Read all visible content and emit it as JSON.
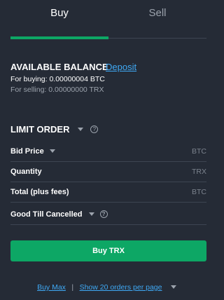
{
  "tabs": [
    {
      "label": "Buy",
      "active": true
    },
    {
      "label": "Sell",
      "active": false
    }
  ],
  "balance": {
    "title": "AVAILABLE BALANCE",
    "deposit_link": "Deposit",
    "for_buying": "For buying: 0.00000004 BTC",
    "for_selling": "For selling: 0.00000000 TRX"
  },
  "order_type": {
    "label": "LIMIT ORDER",
    "help_icon": "?"
  },
  "fields": {
    "bid_price": {
      "label": "Bid Price",
      "unit": "BTC"
    },
    "quantity": {
      "label": "Quantity",
      "unit": "TRX"
    },
    "total": {
      "label": "Total (plus fees)",
      "unit": "BTC"
    },
    "time_in_force": {
      "label": "Good Till Cancelled",
      "help_icon": "?"
    }
  },
  "submit": {
    "label": "Buy TRX"
  },
  "footer": {
    "buy_max": "Buy Max",
    "separator": "|",
    "show_orders": "Show 20 orders per page"
  },
  "colors": {
    "background": "#252b36",
    "accent": "#0da765",
    "link": "#3fa9f5",
    "muted": "#9ca3ad",
    "divider": "#3d4552"
  }
}
